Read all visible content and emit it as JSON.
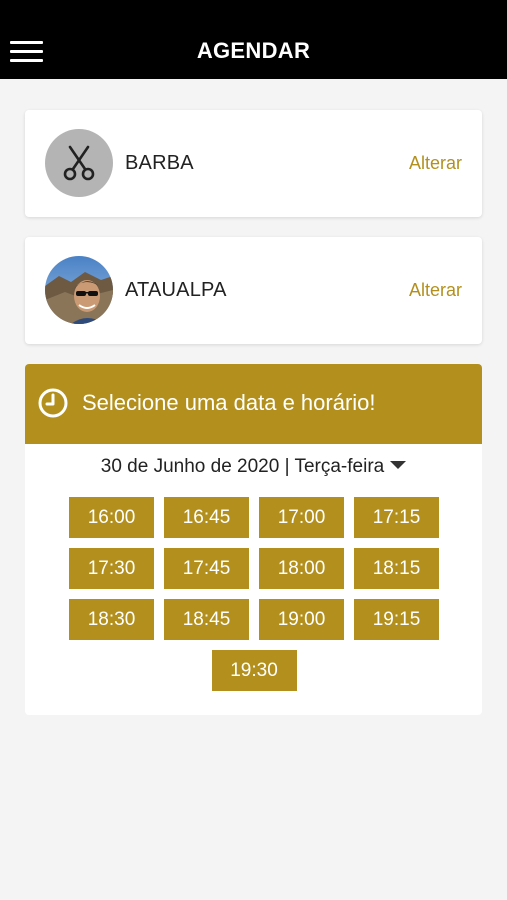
{
  "header": {
    "title": "AGENDAR",
    "menu_icon": "hamburger-menu-icon"
  },
  "service": {
    "label": "BARBA",
    "icon": "scissors-icon",
    "action": "Alterar"
  },
  "professional": {
    "label": "ATAUALPA",
    "action": "Alterar"
  },
  "schedule": {
    "title": "Selecione uma data e horário!",
    "icon": "clock-icon",
    "date_label": "30 de Junho de 2020 | Terça-feira",
    "slots": [
      "16:00",
      "16:45",
      "17:00",
      "17:15",
      "17:30",
      "17:45",
      "18:00",
      "18:15",
      "18:30",
      "18:45",
      "19:00",
      "19:15",
      "19:30"
    ]
  },
  "colors": {
    "accent": "#b3901e",
    "header_bg": "#000000",
    "page_bg": "#f4f4f4"
  }
}
